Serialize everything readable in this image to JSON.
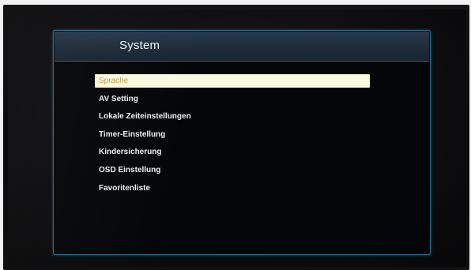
{
  "osd": {
    "title": "System",
    "menu": [
      {
        "label": "Sprache",
        "selected": true
      },
      {
        "label": "AV Setting",
        "selected": false
      },
      {
        "label": "Lokale Zeiteinstellungen",
        "selected": false
      },
      {
        "label": "Timer-Einstellung",
        "selected": false
      },
      {
        "label": "Kindersicherung",
        "selected": false
      },
      {
        "label": "OSD Einstellung",
        "selected": false
      },
      {
        "label": "Favoritenliste",
        "selected": false
      }
    ],
    "colors": {
      "highlight_bg": "#fbfadf",
      "highlight_text": "#c49a3a",
      "item_text": "#eef0f2",
      "border_accent": "#2b6d8f"
    }
  }
}
